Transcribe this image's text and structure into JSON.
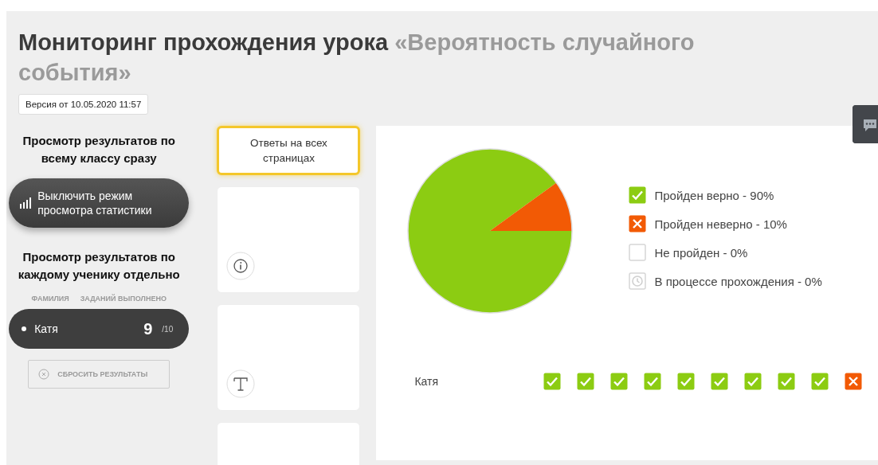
{
  "title": {
    "main": "Мониторинг прохождения урока",
    "lesson": "«Вероятность случайного события»"
  },
  "version": "Версия от 10.05.2020 11:57",
  "class_section": {
    "heading": "Просмотр результатов по всему классу сразу",
    "toggle_button": "Выключить режим просмотра статистики"
  },
  "student_section": {
    "heading": "Просмотр результатов по каждому ученику отдельно",
    "columns": [
      "ФАМИЛИЯ",
      "ЗАДАНИЙ ВЫПОЛНЕНО"
    ],
    "students": [
      {
        "name": "Катя",
        "done": "9",
        "total": "/10",
        "selected": true
      }
    ],
    "reset_button": "СБРОСИТЬ РЕЗУЛЬТАТЫ"
  },
  "pages": [
    {
      "kind": "all",
      "label": "Ответы на всех страницах",
      "selected": true
    },
    {
      "kind": "info",
      "selected": false
    },
    {
      "kind": "text",
      "selected": false
    },
    {
      "kind": "blank",
      "selected": false
    }
  ],
  "chart_data": {
    "type": "pie",
    "categories": [
      "Пройден верно - 90%",
      "Пройден неверно - 10%",
      "Не пройден - 0%",
      "В процессе прохождения - 0%"
    ],
    "values": [
      90,
      10,
      0,
      0
    ]
  },
  "legend": [
    {
      "kind": "correct"
    },
    {
      "kind": "wrong"
    },
    {
      "kind": "none"
    },
    {
      "kind": "progress"
    }
  ],
  "results": [
    {
      "student": "Катя",
      "tasks": [
        {
          "kind": "correct"
        },
        {
          "kind": "correct"
        },
        {
          "kind": "correct"
        },
        {
          "kind": "correct"
        },
        {
          "kind": "correct"
        },
        {
          "kind": "correct"
        },
        {
          "kind": "correct"
        },
        {
          "kind": "correct"
        },
        {
          "kind": "correct"
        },
        {
          "kind": "wrong"
        }
      ]
    }
  ]
}
